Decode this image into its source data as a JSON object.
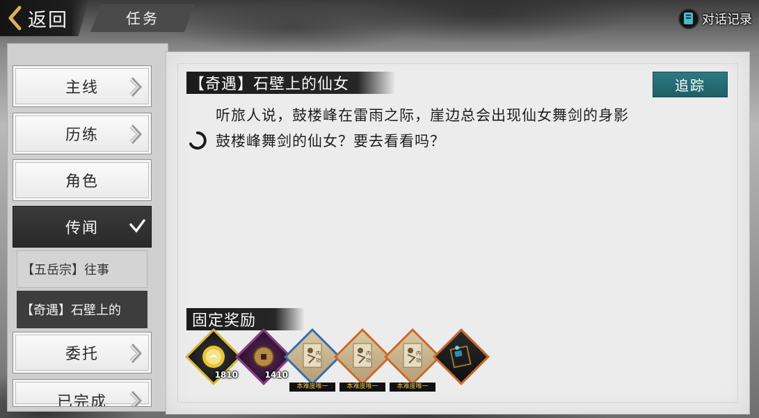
{
  "topbar": {
    "back_label": "返回",
    "title": "任务",
    "dialog_log_label": "对话记录"
  },
  "nav": {
    "items": [
      {
        "label": "主线"
      },
      {
        "label": "历练"
      },
      {
        "label": "角色"
      },
      {
        "label": "传闻"
      },
      {
        "label": "委托"
      },
      {
        "label": "已完成"
      }
    ],
    "sub_items": [
      {
        "label": "【五岳宗】往事"
      },
      {
        "label": "【奇遇】石壁上的"
      }
    ]
  },
  "quest": {
    "title": "【奇遇】石壁上的仙女",
    "track_label": "追踪",
    "description": "听旅人说，鼓楼峰在雷雨之际，崖边总会出现仙女舞剑的身影",
    "objective": "鼓楼峰舞剑的仙女？要去看看吗？"
  },
  "rewards": {
    "title": "固定奖励",
    "items": [
      {
        "icon": "gold-orb-icon",
        "qty": "1810"
      },
      {
        "icon": "copper-coin-icon",
        "qty": "1410"
      },
      {
        "icon": "martial-scroll-icon",
        "tag": "本难度唯一"
      },
      {
        "icon": "martial-scroll-icon",
        "tag": "本难度唯一"
      },
      {
        "icon": "martial-scroll-icon",
        "tag": "本难度唯一"
      },
      {
        "icon": "skill-book-icon"
      }
    ]
  },
  "colors": {
    "accent_teal": "#2d7a82",
    "gold_border": "#c9a832",
    "purple_border": "#8a3a8a",
    "blue_border": "#3a6aa8",
    "orange_border": "#c8692a"
  }
}
